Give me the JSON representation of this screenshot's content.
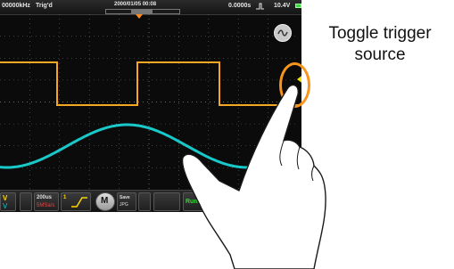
{
  "status_bar": {
    "sample_rate": "00000kHz",
    "trigger_status": "Trig'd",
    "datetime": "2000/01/05  00:08",
    "trigger_position": "0.0000s",
    "trigger_level": "10.4V",
    "trigger_edge_icon": "rising-edge-icon",
    "battery_icon": "battery-icon"
  },
  "waveforms": {
    "ch1_color": "#f5a623",
    "ch2_color": "#19c9c9",
    "grid_color": "#6a6a6a",
    "background": "#0b0b0b"
  },
  "menu_bar": {
    "ch1_label": "V",
    "ch2_label": "V",
    "timebase_value": "200us",
    "timebase_sub": "5MSa/s",
    "trigger_label": "1",
    "math_label": "M",
    "save_line1": "Save",
    "save_line2": "JPG",
    "run_stop_label": "Run/Stop"
  },
  "annotation": {
    "callout_line1": "Toggle trigger",
    "callout_line2": "source",
    "ring_color": "#f7941d",
    "icon": "hand-pointer-icon"
  }
}
